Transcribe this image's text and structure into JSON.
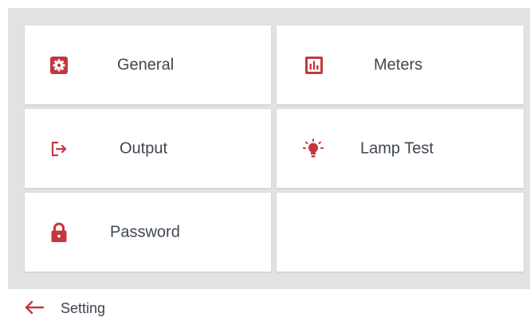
{
  "menu": {
    "tiles": [
      {
        "label": "General",
        "icon": "gear-icon"
      },
      {
        "label": "Meters",
        "icon": "bar-chart-icon"
      },
      {
        "label": "Output",
        "icon": "sign-out-icon"
      },
      {
        "label": "Lamp Test",
        "icon": "lightbulb-icon"
      },
      {
        "label": "Password",
        "icon": "lock-icon"
      }
    ]
  },
  "footer": {
    "title": "Setting",
    "back_icon": "back-arrow-icon"
  },
  "colors": {
    "accent": "#c4373f",
    "panel_background": "#e2e2e2",
    "tile_background": "#ffffff",
    "text": "#3e4650"
  }
}
